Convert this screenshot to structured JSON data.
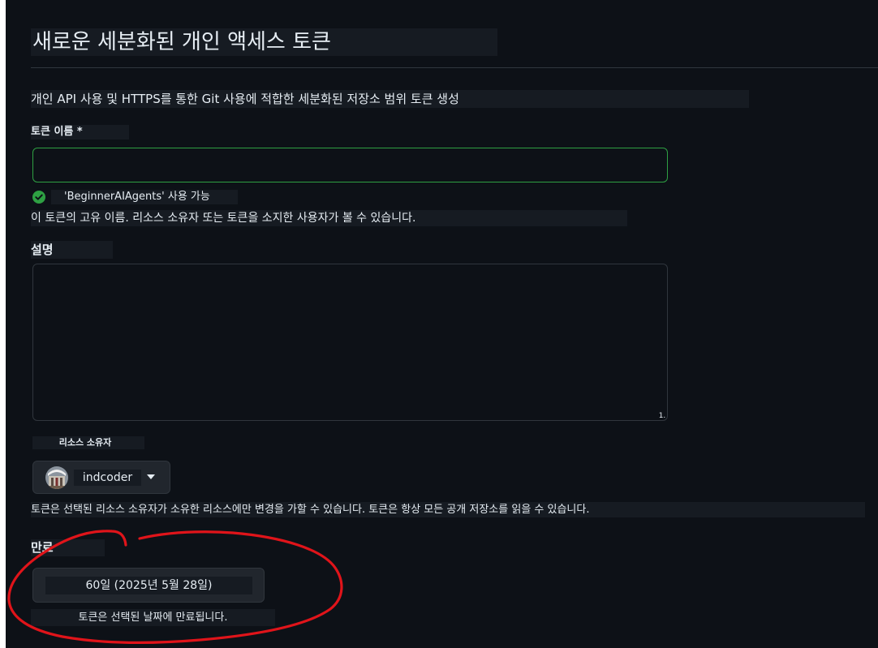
{
  "page": {
    "title": "새로운 세분화된 개인 액세스 토큰",
    "subtitle": "개인 API 사용 및 HTTPS를 통한 Git 사용에 적합한 세분화된 저장소 범위 토큰 생성"
  },
  "token_name": {
    "label": "토큰 이름 *",
    "value": "",
    "availability_text": "'BeginnerAIAgents' 사용 가능",
    "hint": "이 토큰의 고유 이름. 리소스 소유자 또는 토큰을 소지한 사용자가 볼 수 있습니다."
  },
  "description": {
    "label": "설명",
    "value": "",
    "resize_glyph": "1."
  },
  "resource_owner": {
    "label": "리소스 소유자",
    "selected": "indcoder",
    "hint": "토큰은 선택된 리소스 소유자가 소유한 리소스에만 변경을 가할 수 있습니다. 토큰은 항상 모든 공개 저장소를 읽을 수 있습니다."
  },
  "expiration": {
    "label": "만료",
    "selected": "60일 (2025년 5월 28일)",
    "hint": "토큰은 선택된 날짜에 만료됩니다."
  },
  "colors": {
    "background": "#0d1117",
    "success_green": "#2ea043",
    "annotation_red": "#e0141a"
  },
  "icons": {
    "availability": "check-circle-icon",
    "owner_dropdown": "caret-down-icon"
  }
}
